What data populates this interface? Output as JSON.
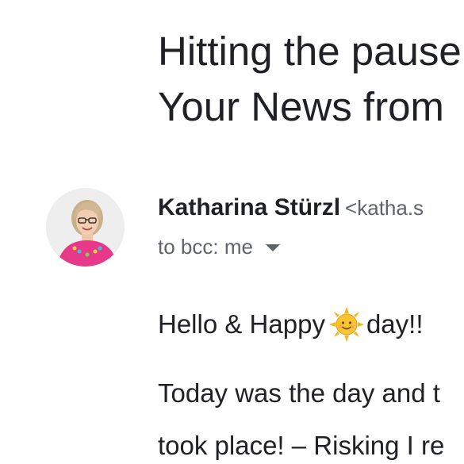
{
  "email": {
    "subject_lines": [
      "Hitting the pause",
      "Your News from"
    ],
    "sender": {
      "name": "Katharina Stürzl",
      "email_partial": "<katha.s"
    },
    "recipients": "to bcc: me",
    "body": {
      "greeting_before": "Hello & Happy",
      "greeting_emoji": "sun-face-icon",
      "greeting_after": "day!!",
      "line1": "Today was the day and t",
      "line2": "took place! – Risking I re"
    }
  },
  "colors": {
    "text": "#202124",
    "secondary_text": "#5f6368",
    "avatar_shirt": "#e8388a",
    "sun": "#f5b81c"
  }
}
